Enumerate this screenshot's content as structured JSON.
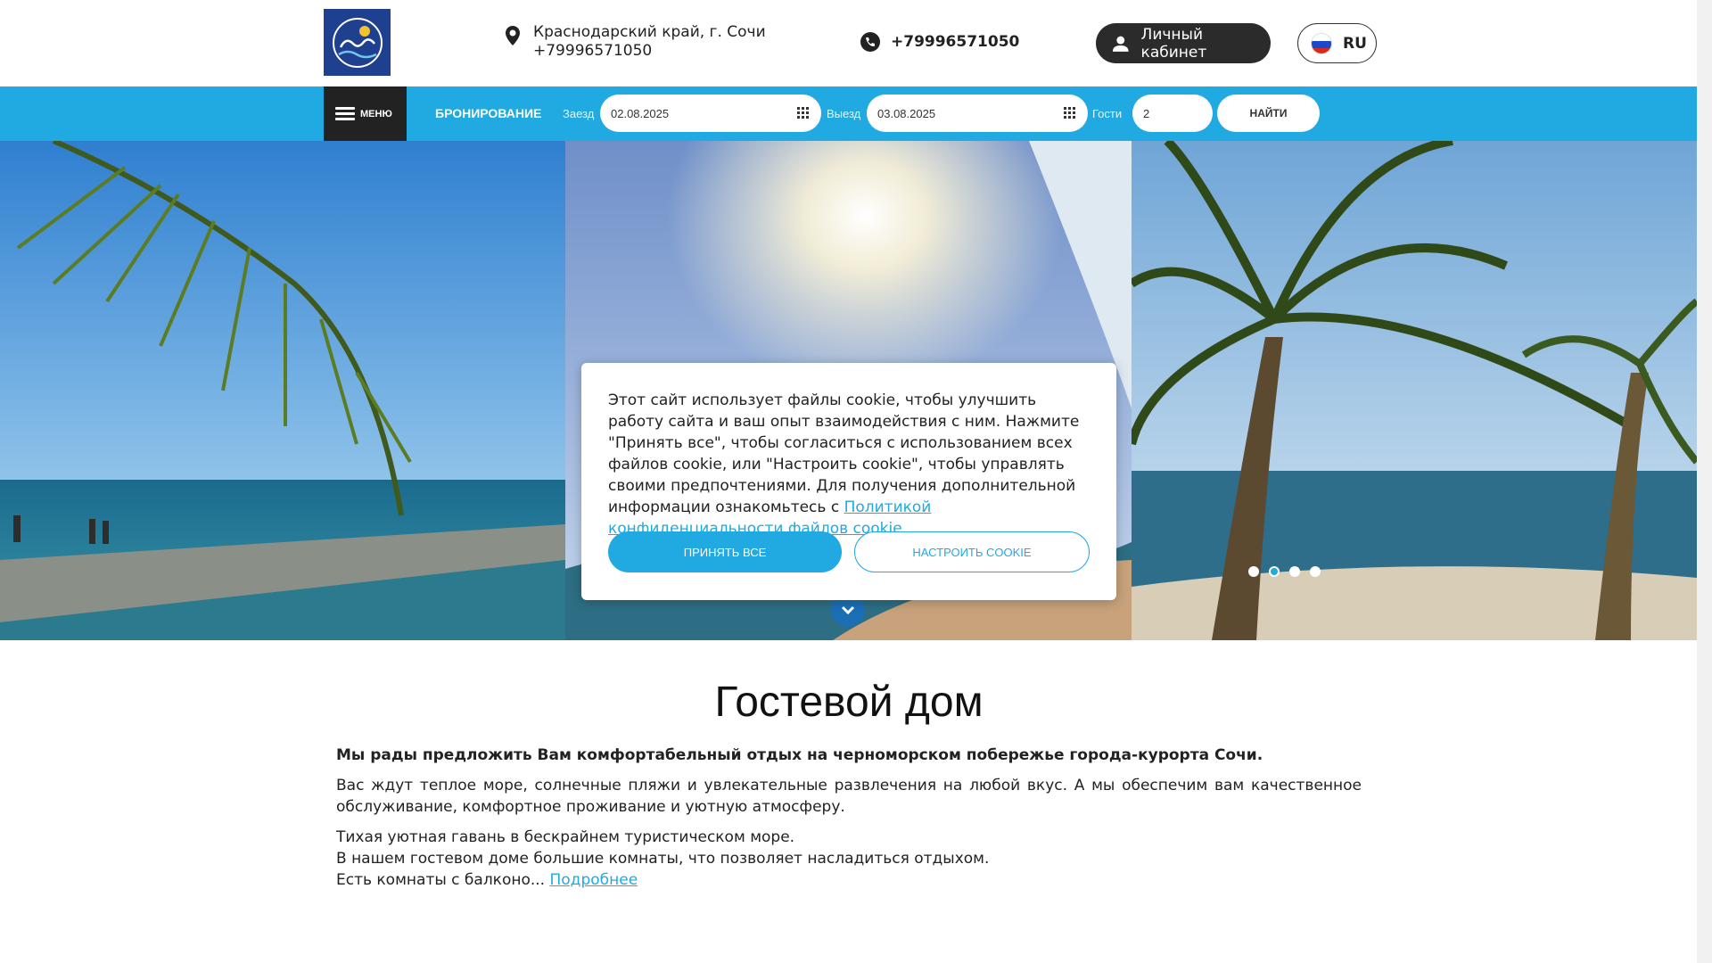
{
  "header": {
    "address": "Краснодарский край, г. Сочи",
    "address_phone": "+79996571050",
    "phone": "+79996571050",
    "cabinet_label": "Личный кабинет",
    "lang_label": "RU"
  },
  "booking": {
    "menu_label": "МЕНЮ",
    "title": "БРОНИРОВАНИЕ",
    "checkin_label": "Заезд",
    "checkin_value": "02.08.2025",
    "checkout_label": "Выезд",
    "checkout_value": "03.08.2025",
    "guests_label": "Гости",
    "guests_value": "2",
    "find_label": "НАЙТИ"
  },
  "hero": {
    "slides_count": 4,
    "active_slide": 2
  },
  "cookie": {
    "text": "Этот сайт использует файлы cookie, чтобы улучшить работу сайта и ваш опыт взаимодействия с ним. Нажмите \"Принять все\", чтобы согласиться с использованием всех файлов cookie, или \"Настроить cookie\", чтобы управлять своими предпочтениями. Для получения дополнительной информации ознакомьтесь с ",
    "link": "Политикой конфиденциальности файлов cookie.",
    "accept_label": "ПРИНЯТЬ ВСЕ",
    "config_label": "НАСТРОИТЬ COOKIE"
  },
  "content": {
    "title": "Гостевой дом",
    "lead": "Мы рады предложить Вам комфортабельный отдых на черноморском побережье города-курорта Сочи.",
    "p1": "Вас ждут теплое море, солнечные пляжи и увлекательные развлечения на любой вкус. А мы обеспечим вам качественное обслуживание, комфортное проживание и уютную атмосферу.",
    "p2_line1": "Тихая уютная гавань в бескрайнем туристическом море.",
    "p2_line2": "В нашем гостевом доме большие комнаты, что позволяет насладиться отдыхом.",
    "p2_line3": "Есть комнаты с балконо...",
    "more_link": "Подробнее"
  },
  "colors": {
    "accent": "#21a9e1",
    "dark": "#222222"
  }
}
